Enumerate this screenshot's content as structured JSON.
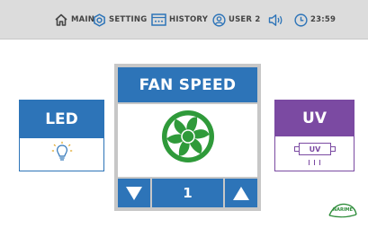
{
  "nav": {
    "main": "MAIN",
    "setting": "SETTING",
    "history": "HISTORY",
    "user": "USER 2",
    "time": "23:59"
  },
  "led": {
    "title": "LED"
  },
  "fan": {
    "title": "FAN SPEED",
    "level": "1"
  },
  "uv": {
    "title": "UV",
    "lamp_label": "UV"
  },
  "brand": {
    "logo": "NARIME"
  },
  "colors": {
    "topbar": "#dcdcdc",
    "blue": "#2d74b8",
    "purple": "#7b4aa2",
    "fan_green": "#2f9a3a",
    "frame_gray": "#c7c7c7"
  }
}
